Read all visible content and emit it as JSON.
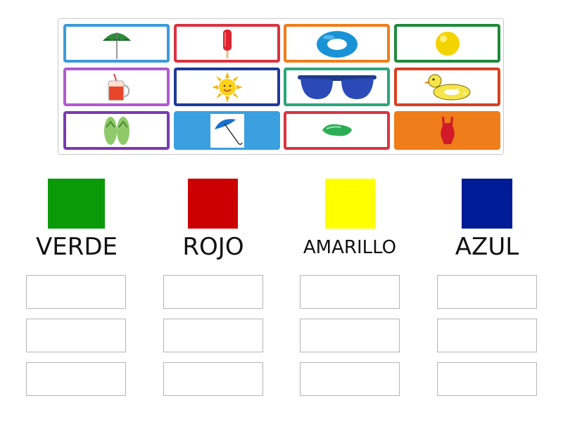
{
  "items": [
    {
      "icon": "beach-umbrella-icon",
      "border": "#3a9ad9",
      "fill": ""
    },
    {
      "icon": "popsicle-icon",
      "border": "#d9343f",
      "fill": ""
    },
    {
      "icon": "swim-ring-icon",
      "border": "#ef7d1a",
      "fill": ""
    },
    {
      "icon": "yellow-ball-icon",
      "border": "#1f8a3a",
      "fill": ""
    },
    {
      "icon": "juice-jar-icon",
      "border": "#b05ad0",
      "fill": ""
    },
    {
      "icon": "sun-icon",
      "border": "#1e3a9a",
      "fill": ""
    },
    {
      "icon": "sunglasses-icon",
      "border": "#2aa67a",
      "fill": ""
    },
    {
      "icon": "duck-float-icon",
      "border": "#d94020",
      "fill": ""
    },
    {
      "icon": "flip-flops-icon",
      "border": "#7a3ab0",
      "fill": ""
    },
    {
      "icon": "blue-umbrella-icon",
      "border": "",
      "fill": "#3aa0e0"
    },
    {
      "icon": "green-sunglasses-icon",
      "border": "#d9343f",
      "fill": ""
    },
    {
      "icon": "swimsuit-icon",
      "border": "",
      "fill": "#ef7d1a"
    }
  ],
  "categories": [
    {
      "label": "VERDE",
      "color": "#0a9a0a"
    },
    {
      "label": "ROJO",
      "color": "#cc0000"
    },
    {
      "label": "AMARILLO",
      "color": "#ffff00"
    },
    {
      "label": "AZUL",
      "color": "#001b96"
    }
  ]
}
